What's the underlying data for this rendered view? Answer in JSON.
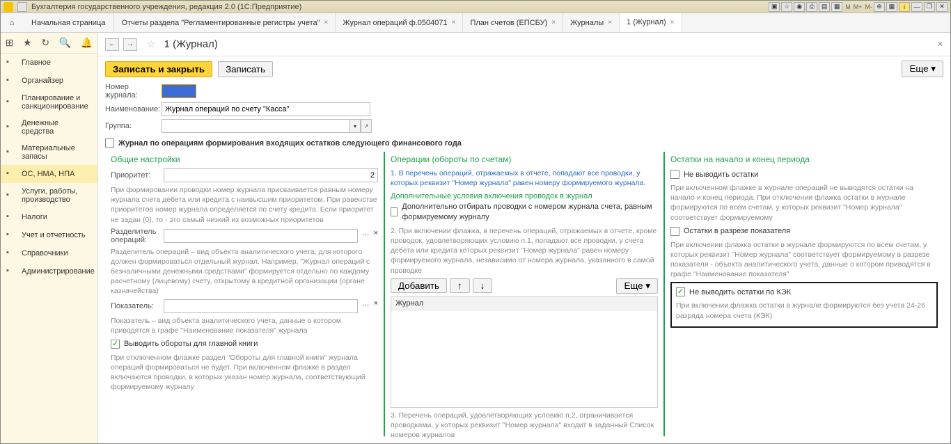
{
  "window": {
    "title": "Бухгалтерия государственного учреждения, редакция 2.0   (1С:Предприятие)",
    "m_buttons": [
      "M",
      "M+",
      "M-"
    ]
  },
  "tabs": {
    "start": "Начальная страница",
    "items": [
      {
        "label": "Отчеты раздела \"Регламентированные регистры учета\""
      },
      {
        "label": "Журнал операций ф.0504071"
      },
      {
        "label": "План счетов (ЕПСБУ)"
      },
      {
        "label": "Журналы"
      },
      {
        "label": "1 (Журнал)",
        "active": true
      }
    ]
  },
  "sidebar": [
    {
      "label": "Главное"
    },
    {
      "label": "Органайзер"
    },
    {
      "label": "Планирование и санкционирование"
    },
    {
      "label": "Денежные средства"
    },
    {
      "label": "Материальные запасы"
    },
    {
      "label": "ОС, НМА, НПА",
      "active": true
    },
    {
      "label": "Услуги, работы, производство"
    },
    {
      "label": "Налоги"
    },
    {
      "label": "Учет и отчетность"
    },
    {
      "label": "Справочники"
    },
    {
      "label": "Администрирование"
    }
  ],
  "page": {
    "title": "1 (Журнал)",
    "save_close": "Записать и закрыть",
    "save": "Записать",
    "more": "Еще",
    "number_label": "Номер журнала:",
    "number_value": "",
    "name_label": "Наименование:",
    "name_value": "Журнал операций по счету \"Касса\"",
    "group_label": "Группа:",
    "group_value": "",
    "chk_year": "Журнал по операциям формирования входящих остатков следующего финансового года"
  },
  "col1": {
    "h": "Общие настройки",
    "prio_label": "Приоритет:",
    "prio_value": "2",
    "prio_help": "При формировании проводки номер журнала присваивается равным номеру журнала счета дебета или кредита с наивысшим приоритетом. При равенстве приоритетов номер журнала определяется по счету кредита. Если приоритет не задан (0), то - это самый низкий из возможных приоритетов",
    "sep_label": "Разделитель операций:",
    "sep_help": "Разделитель операций – вид объекта аналитического учета, для которого должен формироваться отдельный журнал. Например, \"Журнал операций с безналичными денежными средствами\" формируется отдельно по каждому расчетному (лицевому) счету, открытому в кредитной организации (органе казначейства)",
    "ind_label": "Показатель:",
    "ind_help": "Показатель – вид объекта аналитического учета, данные о котором приводятся в графе \"Наименование показателя\" журнала",
    "chk_mb": "Выводить обороты для главной книги",
    "mb_help": "При отключенном флажке раздел \"Обороты для главной книги\" журнала операций формироваться не будет. При включенном флажке в раздел включаются проводки, в которых указан номер журнала, соответствующий формируемому журналу"
  },
  "col2": {
    "h": "Операции (обороты по счетам)",
    "p1": "1. В перечень операций, отражаемых в отчете, попадают все проводки, у которых реквизит \"Номер журнала\" равен номеру формируемого журнала.",
    "sub": "Дополнительные условия включения проводок в журнал",
    "chk_extra": "Дополнительно отбирать проводки с номером журнала счета, равным формируемому журналу",
    "p2": "2. При включении флажка, в перечень операций, отражаемых в отчете, кроме проводок, удовлетворяющих условию п.1, попадают все проводки, у счета дебета или кредита которых реквизит \"Номер журнала\" равен номеру формируемого журнала, независимо от номера журнала, указанного в самой проводке",
    "add": "Добавить",
    "more": "Еще",
    "list_hdr": "Журнал",
    "p3": "3. Перечень операций, удовлетворяющих условию п.2, ограничивается проводками, у которых реквизит \"Номер журнала\" входит в заданный Список номеров журналов"
  },
  "col3": {
    "h": "Остатки на начало и конец периода",
    "chk1": "Не выводить остатки",
    "h1": "При включенном флажке в журнале операций не выводятся остатки на начало и конец периода. При отключении флажка остатки в журнале формируются по всем счетам, у которых реквизит \"Номер журнала\" соответствует формируемому",
    "chk2": "Остатки в разрезе показателя",
    "h2": "При включении флажка остатки в журнале формируются по всем счетам, у которых реквизит \"Номер журнала\" соответствует формируемому в разрезе показателя - объекта аналитического учета, данные о котором приводятся в графе \"Наименование показателя\"",
    "chk3": "Не выводить остатки по КЭК",
    "h3": "При включении флажка остатки в журнале формируются без учета 24-26 разряда номера счета (КЭК)"
  }
}
